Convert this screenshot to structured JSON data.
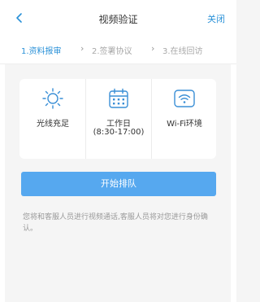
{
  "navbar": {
    "title": "视频验证",
    "close_label": "关闭",
    "back_icon": "chevron-left-icon"
  },
  "steps": [
    {
      "label": "1.资料报审",
      "active": true
    },
    {
      "label": "2.签署协议",
      "active": false
    },
    {
      "label": "3.在线回访",
      "active": false
    }
  ],
  "requirements": [
    {
      "icon": "sun-icon",
      "label": "光线充足",
      "sub": ""
    },
    {
      "icon": "calendar-icon",
      "label": "工作日",
      "sub": "(8:30-17:00)"
    },
    {
      "icon": "wifi-icon",
      "label": "Wi-Fi环境",
      "sub": ""
    }
  ],
  "queue_button": "开始排队",
  "note": "您将和客服人员进行视频通话,客服人员将对您进行身份确认。",
  "colors": {
    "accent": "#2a91d8",
    "button": "#56a8ef",
    "background": "#f5f5f5"
  }
}
